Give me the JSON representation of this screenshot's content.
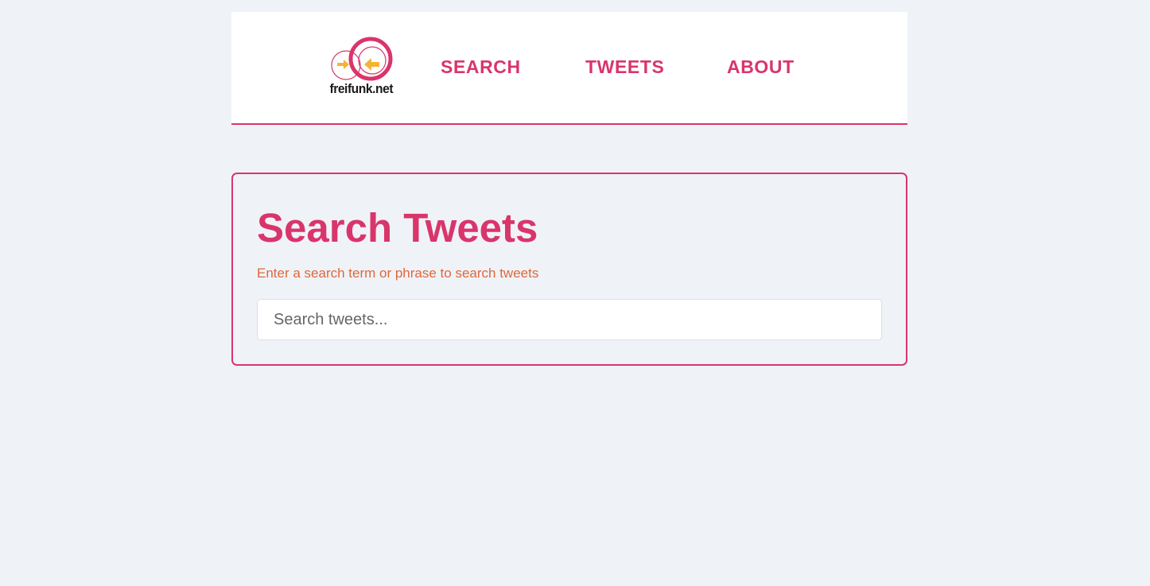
{
  "header": {
    "logo_text": "freifunk.net",
    "nav": [
      {
        "label": "SEARCH"
      },
      {
        "label": "TWEETS"
      },
      {
        "label": "ABOUT"
      }
    ]
  },
  "search_card": {
    "title": "Search Tweets",
    "subtitle": "Enter a search term or phrase to search tweets",
    "input_placeholder": "Search tweets...",
    "input_value": ""
  },
  "colors": {
    "accent": "#d9356b",
    "subtitle": "#e0663a",
    "logo_arrow": "#f5b335",
    "background": "#eff3f8"
  }
}
